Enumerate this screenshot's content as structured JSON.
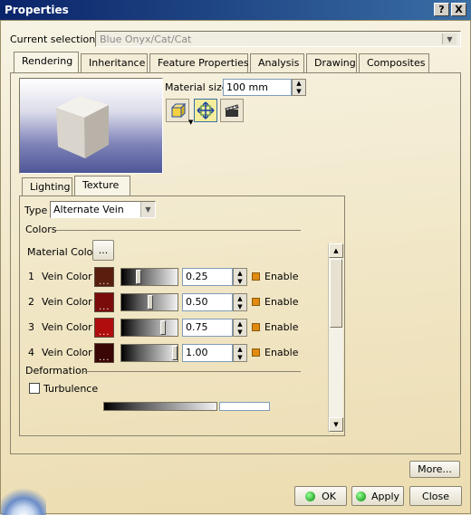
{
  "window": {
    "title": "Properties",
    "help_label": "?",
    "close_label": "X"
  },
  "selection": {
    "label": "Current selection :",
    "value": "Blue Onyx/Cat/Cat"
  },
  "tabs": [
    {
      "label": "Rendering",
      "active": true
    },
    {
      "label": "Inheritance",
      "active": false
    },
    {
      "label": "Feature Properties",
      "active": false
    },
    {
      "label": "Analysis",
      "active": false
    },
    {
      "label": "Drawing",
      "active": false
    },
    {
      "label": "Composites",
      "active": false
    }
  ],
  "material_size": {
    "label": "Material size:",
    "value": "100 mm"
  },
  "subtabs": [
    {
      "label": "Lighting",
      "active": false
    },
    {
      "label": "Texture",
      "active": true
    }
  ],
  "texture": {
    "type_label": "Type",
    "type_value": "Alternate Vein",
    "colors_group": "Colors",
    "material_color_label": "Material Color",
    "material_color_swatch": "...",
    "veins": [
      {
        "num": "1",
        "label": "Vein Color",
        "value": "0.25",
        "level": 0.25,
        "color": "#5a1e0e",
        "enable": "Enable"
      },
      {
        "num": "2",
        "label": "Vein Color",
        "value": "0.50",
        "level": 0.5,
        "color": "#7a0c0c",
        "enable": "Enable"
      },
      {
        "num": "3",
        "label": "Vein Color",
        "value": "0.75",
        "level": 0.75,
        "color": "#b00e0e",
        "enable": "Enable"
      },
      {
        "num": "4",
        "label": "Vein Color",
        "value": "1.00",
        "level": 1.0,
        "color": "#3a0606",
        "enable": "Enable"
      }
    ],
    "deformation_group": "Deformation",
    "turbulence_label": "Turbulence",
    "turbulence_checked": false
  },
  "buttons": {
    "more": "More...",
    "ok": "OK",
    "apply": "Apply",
    "close": "Close"
  }
}
